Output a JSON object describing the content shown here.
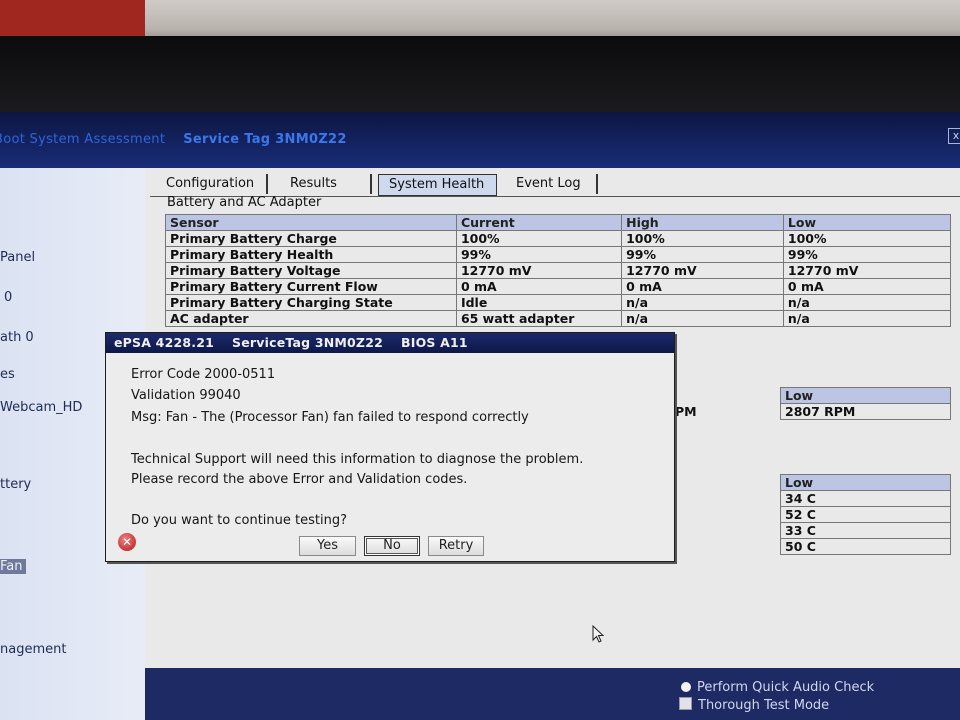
{
  "window": {
    "title": "Boot System Assessment",
    "service_tag_label": "Service Tag 3NM0Z22",
    "close_glyph": "x"
  },
  "sidebar": {
    "items": [
      {
        "label": "Panel"
      },
      {
        "label": "0"
      },
      {
        "label": "ath 0"
      },
      {
        "label": "es"
      },
      {
        "label": "Webcam_HD"
      },
      {
        "label": "ttery"
      },
      {
        "label": "Fan"
      },
      {
        "label": "nagement"
      }
    ]
  },
  "tabs": [
    {
      "label": "Configuration"
    },
    {
      "label": "Results"
    },
    {
      "label": "System Health"
    },
    {
      "label": "Event Log"
    }
  ],
  "battery": {
    "group_title": "Battery and AC Adapter",
    "headers": [
      "Sensor",
      "Current",
      "High",
      "Low"
    ],
    "rows": [
      [
        "Primary Battery Charge",
        "100%",
        "100%",
        "100%"
      ],
      [
        "Primary Battery Health",
        "99%",
        "99%",
        "99%"
      ],
      [
        "Primary Battery Voltage",
        "12770 mV",
        "12770 mV",
        "12770 mV"
      ],
      [
        "Primary Battery Current Flow",
        "0 mA",
        "0 mA",
        "0 mA"
      ],
      [
        "Primary Battery Charging State",
        "Idle",
        "n/a",
        "n/a"
      ],
      [
        "AC adapter",
        "65 watt adapter",
        "n/a",
        "n/a"
      ]
    ]
  },
  "fan": {
    "header_low": "Low",
    "high_fragment": "PM",
    "low_value": "2807 RPM"
  },
  "thermal": {
    "header_low": "Low",
    "low_values": [
      "34 C",
      "52 C",
      "33 C",
      "50 C"
    ]
  },
  "bottom": {
    "quick_audio": "Perform Quick Audio Check",
    "thorough": "Thorough Test Mode"
  },
  "dialog": {
    "title_version": "ePSA 4228.21",
    "title_service_tag": "ServiceTag 3NM0Z22",
    "title_bios": "BIOS A11",
    "error_code": "Error Code 2000-0511",
    "validation": "Validation 99040",
    "msg": "Msg: Fan - The (Processor Fan) fan failed to respond correctly",
    "support_line1": "Technical Support will need this information to diagnose the problem.",
    "support_line2": "Please record the above Error and Validation codes.",
    "question": "Do you want to continue testing?",
    "buttons": {
      "yes": "Yes",
      "no": "No",
      "retry": "Retry"
    }
  },
  "colors": {
    "title_bar": "#1a2c78",
    "table_header": "#bcc6e4",
    "dialog_title": "#0d1848"
  }
}
